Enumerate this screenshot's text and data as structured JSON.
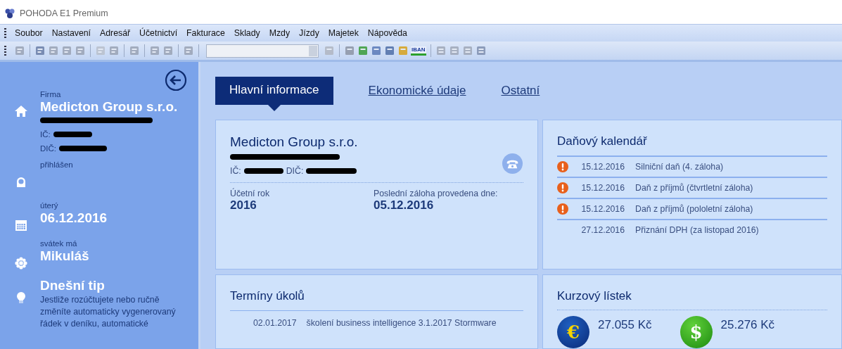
{
  "window": {
    "title": "POHODA E1 Premium"
  },
  "menu": [
    {
      "label": "Soubor"
    },
    {
      "label": "Nastavení"
    },
    {
      "label": "Adresář"
    },
    {
      "label": "Účetnictví"
    },
    {
      "label": "Fakturace"
    },
    {
      "label": "Sklady"
    },
    {
      "label": "Mzdy"
    },
    {
      "label": "Jízdy"
    },
    {
      "label": "Majetek"
    },
    {
      "label": "Nápověda"
    }
  ],
  "toolbar": {
    "badge": "IBAN"
  },
  "sidebar": {
    "company_label": "Firma",
    "company": "Medicton Group s.r.o.",
    "ic_label": "IČ:",
    "dic_label": "DIČ:",
    "user_label": "přihlášen",
    "day": "úterý",
    "date": "06.12.2016",
    "nameday_label": "svátek má",
    "nameday": "Mikuláš",
    "tip_title": "Dnešní tip",
    "tip_text": "Jestliže rozúčtujete nebo ručně změníte automaticky vygenerovaný řádek v deníku, automatické"
  },
  "tabs": [
    {
      "label": "Hlavní informace",
      "selected": true
    },
    {
      "label": "Ekonomické údaje",
      "selected": false
    },
    {
      "label": "Ostatní",
      "selected": false
    }
  ],
  "company_card": {
    "name": "Medicton Group s.r.o.",
    "ic_label": "IČ:",
    "dic_label": "DIČ:",
    "fiscal_year_label": "Účetní rok",
    "fiscal_year": "2016",
    "backup_label": "Poslední záloha provedena dne:",
    "backup_date": "05.12.2016"
  },
  "tax_calendar": {
    "title": "Daňový kalendář",
    "rows": [
      {
        "date": "15.12.2016",
        "text": "Silniční daň (4. záloha)",
        "warning": true
      },
      {
        "date": "15.12.2016",
        "text": "Daň z příjmů (čtvrtletní záloha)",
        "warning": true
      },
      {
        "date": "15.12.2016",
        "text": "Daň z příjmů (pololetní záloha)",
        "warning": true
      },
      {
        "date": "27.12.2016",
        "text": "Přiznání DPH (za listopad 2016)",
        "warning": false
      }
    ]
  },
  "tasks": {
    "title": "Termíny úkolů",
    "rows": [
      {
        "date": "02.01.2017",
        "text": "školení business intelligence 3.1.2017 Stormware"
      }
    ]
  },
  "rates": {
    "title": "Kurzový lístek",
    "items": [
      {
        "kind": "euro",
        "symbol": "€",
        "value": "27.055 Kč"
      },
      {
        "kind": "dollar",
        "symbol": "$",
        "value": "25.276 Kč"
      }
    ]
  }
}
